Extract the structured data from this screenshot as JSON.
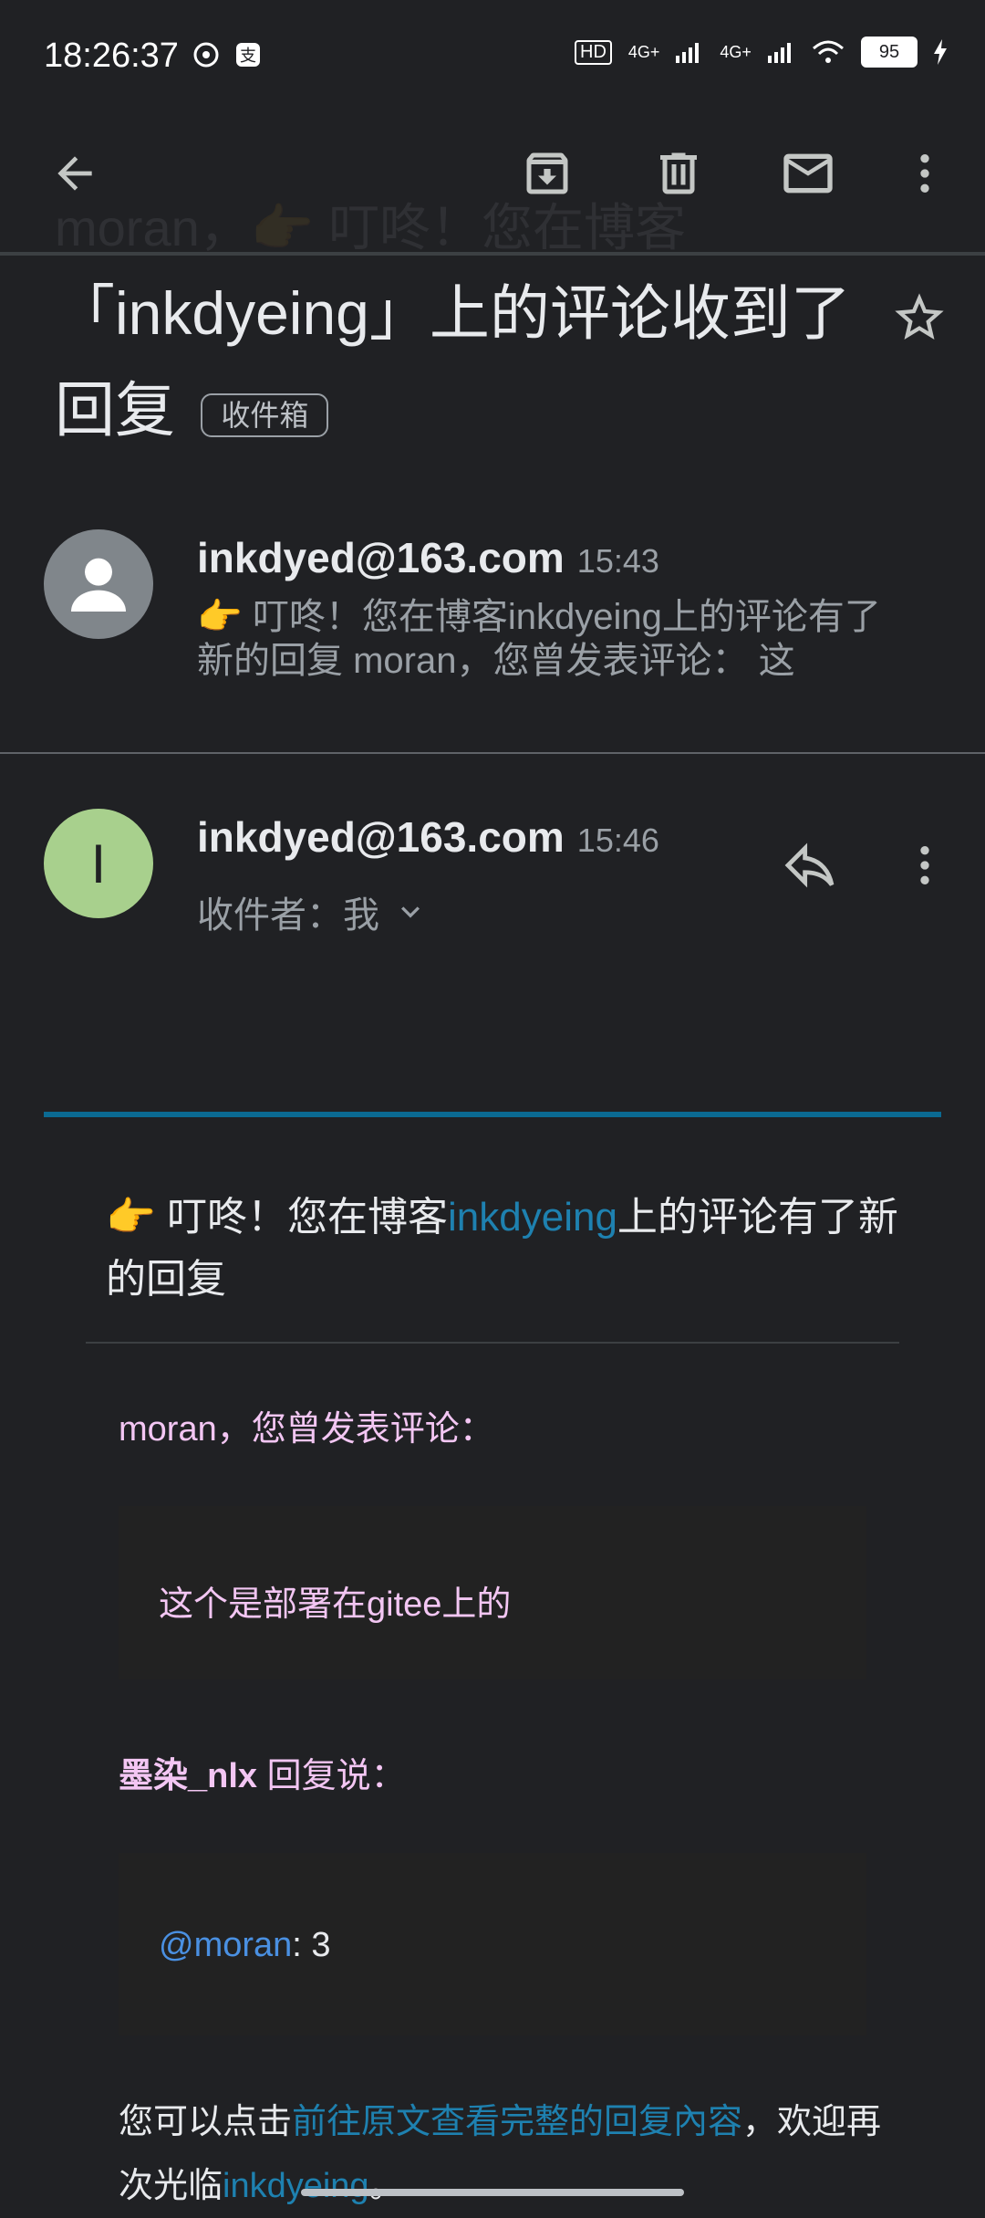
{
  "status": {
    "time": "18:26:37",
    "battery": "95",
    "network1": "4G+",
    "network2": "4G+",
    "hd": "HD"
  },
  "topbar": {
    "ghost_title": "moran，👉 叮咚！您在博客"
  },
  "subject": {
    "text": "「inkdyeing」上的评论收到了回复",
    "label": "收件箱"
  },
  "messages": [
    {
      "sender": "inkdyed@163.com",
      "time": "15:43",
      "preview": "👉 叮咚！您在博客inkdyeing上的评论有了新的回复 moran，您曾发表评论： 这"
    },
    {
      "sender": "inkdyed@163.com",
      "time": "15:46",
      "avatar_letter": "I",
      "recipient": "收件者：我"
    }
  ],
  "email_body": {
    "title_pre": "👉 叮咚！您在博客",
    "title_link": "inkdyeing",
    "title_post": "上的评论有了新的回复",
    "intro": "moran，您曾发表评论：",
    "comment": "这个是部署在gitee上的",
    "replier": "墨染_nlx",
    "replied_label": " 回复说：",
    "reply_mention": "@moran",
    "reply_text": ": 3",
    "outro_pre": "您可以点击",
    "outro_link": "前往原文查看完整的回复內容",
    "outro_mid": "，欢迎再次光临",
    "outro_link2": "inkdyeing",
    "outro_post": "。"
  },
  "colors": {
    "background": "#202124",
    "accent_bar": "#0b6a92",
    "link": "#1e81b0",
    "avatar_green": "#a8d08d",
    "avatar_grey": "#80868b",
    "pink_text": "#f3c6f3"
  }
}
